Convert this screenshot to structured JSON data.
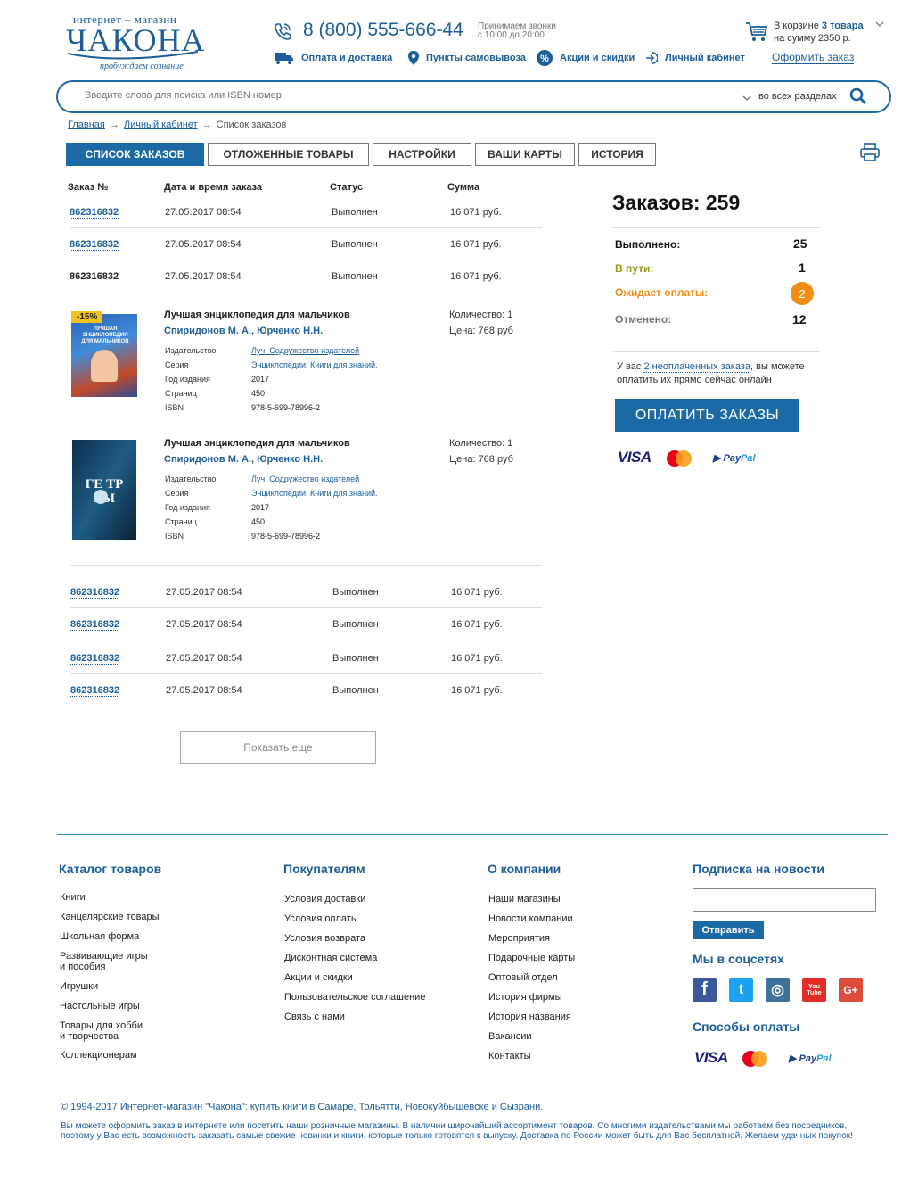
{
  "header": {
    "logo_top": "интернет – магазин",
    "logo_main": "ЧАКОНА",
    "logo_sub": "пробуждаем сознание",
    "phone": "8 (800) 555-666-44",
    "calls_line1": "Принимаем звонки",
    "calls_line2": "с 10:00 до 20:00",
    "nav": [
      {
        "label": "Оплата и доставка",
        "icon": "truck-icon"
      },
      {
        "label": "Пункты самовывоза",
        "icon": "map-pin-icon"
      },
      {
        "label": "Акции и скидки",
        "icon": "percent-icon"
      },
      {
        "label": "Личный кабинет",
        "icon": "login-icon"
      }
    ],
    "cart_prefix": "В корзине",
    "cart_count": "3 товара",
    "cart_sum": "на сумму 2350 р.",
    "checkout": "Оформить заказ"
  },
  "search": {
    "placeholder": "Введите слова для поиска или ISBN номер",
    "scope": "во всех разделах"
  },
  "breadcrumbs": [
    "Главная",
    "Личный кабинет",
    "Список заказов"
  ],
  "tabs": [
    "Список заказов",
    "Отложенные товары",
    "Настройки",
    "Ваши карты",
    "История"
  ],
  "orders": {
    "headers": [
      "Заказ №",
      "Дата и время заказа",
      "Статус",
      "Сумма"
    ],
    "rows": [
      {
        "num": "862316832",
        "date": "27.05.2017 08:54",
        "status": "Выполнен",
        "sum": "16 071 руб."
      },
      {
        "num": "862316832",
        "date": "27.05.2017 08:54",
        "status": "Выполнен",
        "sum": "16 071 руб."
      },
      {
        "num": "862316832",
        "date": "27.05.2017 08:54",
        "status": "Выполнен",
        "sum": "16 071 руб."
      }
    ],
    "rows_after": [
      {
        "num": "862316832",
        "date": "27.05.2017 08:54",
        "status": "Выполнен",
        "sum": "16 071 руб."
      },
      {
        "num": "862316832",
        "date": "27.05.2017 08:54",
        "status": "Выполнен",
        "sum": "16 071 руб."
      },
      {
        "num": "862316832",
        "date": "27.05.2017 08:54",
        "status": "Выполнен",
        "sum": "16 071 руб."
      },
      {
        "num": "862316832",
        "date": "27.05.2017 08:54",
        "status": "Выполнен",
        "sum": "16 071 руб."
      }
    ],
    "more": "Показать еще"
  },
  "products": [
    {
      "discount": "-15%",
      "cover_text": "ЛУЧШАЯ ЭНЦИКЛОПЕДИЯ ДЛЯ МАЛЬЧИКОВ",
      "title": "Лучшая энциклопедия для мальчиков",
      "authors": "Спиридонов М. А., Юрченко Н.Н.",
      "qty": "Количество: 1",
      "price": "Цена: 768 руб",
      "props": [
        {
          "label": "Издательство",
          "value": "Луч, Содружество издателей"
        },
        {
          "label": "Серия",
          "value": "Энциклопедии. Книги для знаний."
        },
        {
          "label": "Год издания",
          "value": "2017"
        },
        {
          "label": "Страниц",
          "value": "450"
        },
        {
          "label": "ISBN",
          "value": "978-5-699-78996-2"
        }
      ]
    },
    {
      "cover_text": "ГЕ ТР РЫ",
      "title": "Лучшая энциклопедия для мальчиков",
      "authors": "Спиридонов М. А., Юрченко Н.Н.",
      "qty": "Количество: 1",
      "price": "Цена: 768 руб",
      "props": [
        {
          "label": "Издательство",
          "value": "Луч, Содружество издателей"
        },
        {
          "label": "Серия",
          "value": "Энциклопедии. Книги для знаний."
        },
        {
          "label": "Год издания",
          "value": "2017"
        },
        {
          "label": "Страниц",
          "value": "450"
        },
        {
          "label": "ISBN",
          "value": "978-5-699-78996-2"
        }
      ]
    }
  ],
  "summary": {
    "title": "Заказов: 259",
    "items": [
      {
        "label": "Выполнено:",
        "value": "25",
        "color": "#111111"
      },
      {
        "label": "В пути:",
        "value": "1",
        "color": "#9a9a1a"
      },
      {
        "label": "Ожидает оплаты:",
        "value": "2",
        "color": "#f28c12"
      },
      {
        "label": "Отменено:",
        "value": "12",
        "color": "#777777"
      }
    ],
    "unpaid_pre": "У вас",
    "unpaid_link": "2 неоплаченных заказа",
    "unpaid_post": ", вы можете оплатить их прямо сейчас онлайн",
    "pay_button": "Оплатить заказы",
    "pay_methods": [
      "VISA",
      "MasterCard",
      "PayPal"
    ]
  },
  "footer": {
    "catalog": {
      "title": "Каталог товаров",
      "items": [
        "Книги",
        "Канцелярские товары",
        "Школьная форма",
        "Развивающие игры\nи пособия",
        "Игрушки",
        "Настольные игры",
        "Товары для хобби\nи творчества",
        "Коллекционерам"
      ]
    },
    "buyers": {
      "title": "Покупателям",
      "items": [
        "Условия доставки",
        "Условия оплаты",
        "Условия возврата",
        "Дисконтная система",
        "Акции и скидки",
        "Пользовательское соглашение",
        "Связь с нами"
      ]
    },
    "company": {
      "title": "О компании",
      "items": [
        "Наши магазины",
        "Новости компании",
        "Мероприятия",
        "Подарочные карты",
        "Оптовый отдел",
        "История фирмы",
        "История названия",
        "Вакансии",
        "Контакты"
      ]
    },
    "subscribe_title": "Подписка на новости",
    "subscribe_btn": "Отправить",
    "social_title": "Мы в соцсетях",
    "social": [
      {
        "name": "facebook",
        "glyph": "f",
        "color": "#3b5998"
      },
      {
        "name": "twitter",
        "glyph": "t",
        "color": "#1da1f2"
      },
      {
        "name": "instagram",
        "glyph": "◎",
        "color": "#3f729b"
      },
      {
        "name": "youtube",
        "glyph": "You Tube",
        "color": "#e52d27"
      },
      {
        "name": "google-plus",
        "glyph": "G+",
        "color": "#dd4b39"
      }
    ],
    "pay_title": "Способы оплаты",
    "copyright": "© 1994-2017 Интернет-магазин \"Чакона\": купить книги в Самаре, Тольятти, Новокуйбышевске и Сызрани.",
    "about": "Вы можете оформить заказ в интернете или посетить наши розничные магазины. В наличии широчайший ассортимент товаров. Со многими издательствами мы работаем без посредников, поэтому у Вас есть возможность заказать самые свежие новинки и книги, которые только готовятся к выпуску. Доставка по России может быть для Вас бесплатной. Желаем удачных покупок!"
  }
}
